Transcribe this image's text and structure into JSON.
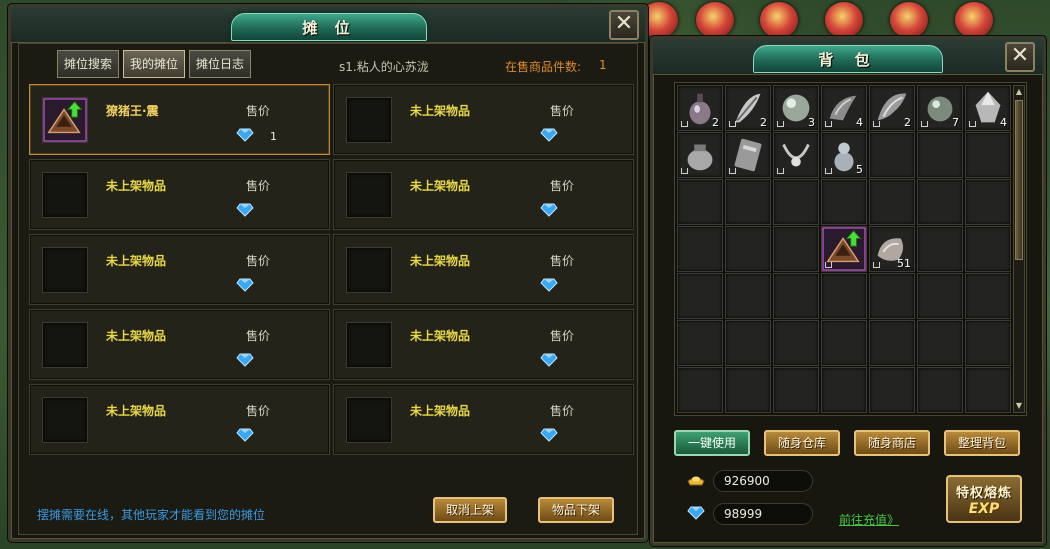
{
  "colors": {
    "accent_teal": "#1f6a56",
    "gold_text": "#f0d060",
    "orange_text": "#e08a2a",
    "hint_blue": "#3a9ae0",
    "link_green": "#48c848"
  },
  "stall": {
    "title": "摊 位",
    "close_icon": "close-icon",
    "tabs": [
      {
        "label": "摊位搜索",
        "active": false
      },
      {
        "label": "我的摊位",
        "active": true
      },
      {
        "label": "摊位日志",
        "active": false
      }
    ],
    "owner_name": "s1.粘人的心苏泷",
    "sale_count_label": "在售商品件数:",
    "sale_count_value": "1",
    "slots": [
      {
        "name": "獠猪王·震",
        "price_label": "售价",
        "price": "1",
        "has_item": true
      },
      {
        "name": "未上架物品",
        "price_label": "售价",
        "price": "",
        "has_item": false
      },
      {
        "name": "未上架物品",
        "price_label": "售价",
        "price": "",
        "has_item": false
      },
      {
        "name": "未上架物品",
        "price_label": "售价",
        "price": "",
        "has_item": false
      },
      {
        "name": "未上架物品",
        "price_label": "售价",
        "price": "",
        "has_item": false
      },
      {
        "name": "未上架物品",
        "price_label": "售价",
        "price": "",
        "has_item": false
      },
      {
        "name": "未上架物品",
        "price_label": "售价",
        "price": "",
        "has_item": false
      },
      {
        "name": "未上架物品",
        "price_label": "售价",
        "price": "",
        "has_item": false
      },
      {
        "name": "未上架物品",
        "price_label": "售价",
        "price": "",
        "has_item": false
      },
      {
        "name": "未上架物品",
        "price_label": "售价",
        "price": "",
        "has_item": false
      }
    ],
    "footer_hint": "摆摊需要在线，其他玩家才能看到您的摊位",
    "cancel_button": "取消上架",
    "unlist_button": "物品下架"
  },
  "bag": {
    "title": "背 包",
    "close_icon": "close-icon",
    "items": [
      {
        "icon": "potion-icon",
        "count": "2"
      },
      {
        "icon": "feather-scroll-icon",
        "count": "2"
      },
      {
        "icon": "orb-icon",
        "count": "3"
      },
      {
        "icon": "horn-icon",
        "count": "4"
      },
      {
        "icon": "wing-icon",
        "count": "2"
      },
      {
        "icon": "sphere-icon",
        "count": "7"
      },
      {
        "icon": "crystal-icon",
        "count": "4"
      },
      {
        "icon": "pouch-icon",
        "count": ""
      },
      {
        "icon": "tablet-icon",
        "count": ""
      },
      {
        "icon": "necklace-icon",
        "count": ""
      },
      {
        "icon": "gourd-icon",
        "count": "5"
      },
      {
        "icon": "triangle-badge-icon",
        "count": ""
      },
      {
        "icon": "horn-bag-icon",
        "count": "51"
      }
    ],
    "buttons": {
      "use_all": "一键使用",
      "storage": "随身仓库",
      "shop": "随身商店",
      "sort": "整理背包"
    },
    "gold_amount": "926900",
    "diamond_amount": "98999",
    "recharge_link": "前往充值》",
    "privilege_label": "特权熔炼",
    "privilege_exp": "EXP"
  }
}
